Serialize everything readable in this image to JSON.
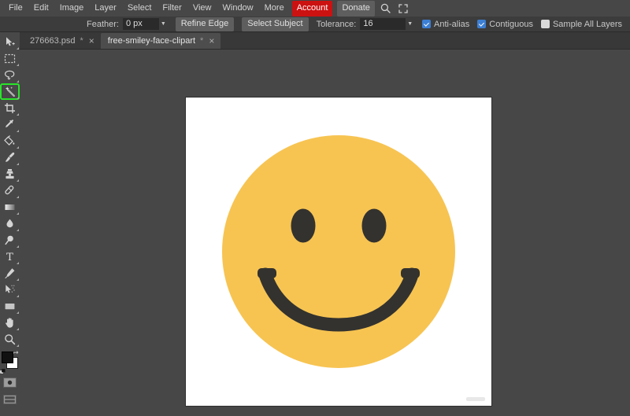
{
  "app": {
    "name": "Photopea",
    "theme_bg": "#474747"
  },
  "menubar": {
    "items": [
      {
        "label": "File",
        "name": "menu-file"
      },
      {
        "label": "Edit",
        "name": "menu-edit"
      },
      {
        "label": "Image",
        "name": "menu-image"
      },
      {
        "label": "Layer",
        "name": "menu-layer"
      },
      {
        "label": "Select",
        "name": "menu-select"
      },
      {
        "label": "Filter",
        "name": "menu-filter"
      },
      {
        "label": "View",
        "name": "menu-view"
      },
      {
        "label": "Window",
        "name": "menu-window"
      },
      {
        "label": "More",
        "name": "menu-more"
      }
    ],
    "account_label": "Account",
    "account_color": "#cc1111",
    "donate_label": "Donate",
    "search_icon": "magnifier-icon",
    "fullscreen_icon": "fullscreen-icon"
  },
  "optionsbar": {
    "feather_label": "Feather:",
    "feather_value": "0 px",
    "refine_edge_label": "Refine Edge",
    "select_subject_label": "Select Subject",
    "tolerance_label": "Tolerance:",
    "tolerance_value": "16",
    "antialias_label": "Anti-alias",
    "antialias_checked": true,
    "contiguous_label": "Contiguous",
    "contiguous_checked": true,
    "sample_all_layers_label": "Sample All Layers",
    "sample_all_layers_checked": false,
    "checkbox_on_color": "#3c7fd4"
  },
  "toolbar": {
    "highlight_color": "#2ae52a",
    "active_tool": "magic-wand-tool",
    "tools": [
      {
        "name": "move-tool",
        "title": "Move Tool"
      },
      {
        "name": "rectangular-marquee-tool",
        "title": "Rectangular Marquee Tool"
      },
      {
        "name": "lasso-tool",
        "title": "Lasso Tool"
      },
      {
        "name": "magic-wand-tool",
        "title": "Magic Wand Tool"
      },
      {
        "name": "crop-tool",
        "title": "Crop Tool"
      },
      {
        "name": "eyedropper-tool",
        "title": "Eyedropper Tool"
      },
      {
        "name": "paint-bucket-tool",
        "title": "Paint Bucket Tool"
      },
      {
        "name": "brush-tool",
        "title": "Brush Tool"
      },
      {
        "name": "clone-stamp-tool",
        "title": "Clone Stamp Tool"
      },
      {
        "name": "eraser-tool",
        "title": "Eraser Tool"
      },
      {
        "name": "gradient-tool",
        "title": "Gradient Tool"
      },
      {
        "name": "blur-tool",
        "title": "Blur Tool"
      },
      {
        "name": "dodge-tool",
        "title": "Dodge Tool"
      },
      {
        "name": "type-tool",
        "title": "Type Tool"
      },
      {
        "name": "pen-tool",
        "title": "Pen Tool"
      },
      {
        "name": "path-select-tool",
        "title": "Path Select Tool"
      },
      {
        "name": "shape-tool",
        "title": "Shape Tool"
      },
      {
        "name": "hand-tool",
        "title": "Hand Tool"
      },
      {
        "name": "zoom-tool",
        "title": "Zoom Tool"
      }
    ],
    "foreground_color": "#111111",
    "background_color": "#ffffff",
    "quick_mask_name": "quick-mask-button",
    "screen_mode_name": "screen-mode-button"
  },
  "tabs": [
    {
      "name": "276663.psd",
      "modified": "*",
      "active": false,
      "close": "×"
    },
    {
      "name": "free-smiley-face-clipart",
      "modified": "*",
      "active": true,
      "close": "×"
    }
  ],
  "canvas": {
    "document_background": "#ffffff",
    "artwork": {
      "name": "smiley-face",
      "face_color": "#f7c452",
      "feature_color": "#33322f"
    },
    "watermark": "watermark-bar"
  }
}
